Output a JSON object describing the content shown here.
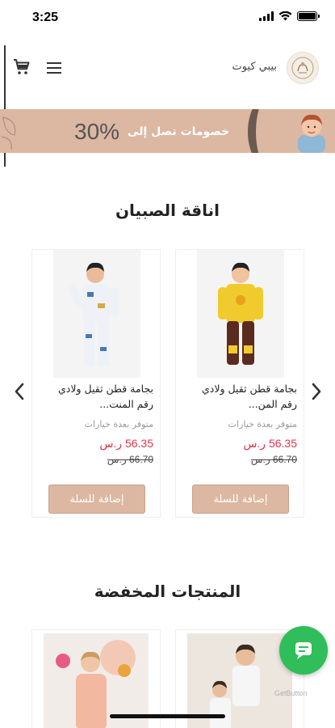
{
  "status_bar": {
    "time": "3:25"
  },
  "header": {
    "brand_name": "بيبي كيوت"
  },
  "banner": {
    "label": "خصومات تصل إلى",
    "percent": "30%"
  },
  "sections": {
    "boys_title": "اناقة الصبيان",
    "discounted_title": "المنتجات المخفضة"
  },
  "products": [
    {
      "name_line1": "بجامة قطن ثقيل ولادي",
      "name_line2": "رقم المن...",
      "availability": "متوفر بعدة خيارات",
      "price": "56.35 ر.س",
      "old_price": "66.70 ر.س",
      "button": "إضافة للسلة"
    },
    {
      "name_line1": "بجامة قطن ثقيل ولادي",
      "name_line2": "رقم المنت...",
      "availability": "متوفر بعدة خيارات",
      "price": "56.35 ر.س",
      "old_price": "66.70 ر.س",
      "button": "إضافة للسلة"
    }
  ],
  "chat": {
    "caption": "GetButton"
  },
  "colors": {
    "accent": "#dcb7a1",
    "price": "#e0344b",
    "chat": "#2fbe5a"
  },
  "icons": [
    "cart-icon",
    "menu-icon",
    "chevron-left-icon",
    "chevron-right-icon",
    "chat-icon",
    "wifi-icon",
    "battery-icon"
  ]
}
